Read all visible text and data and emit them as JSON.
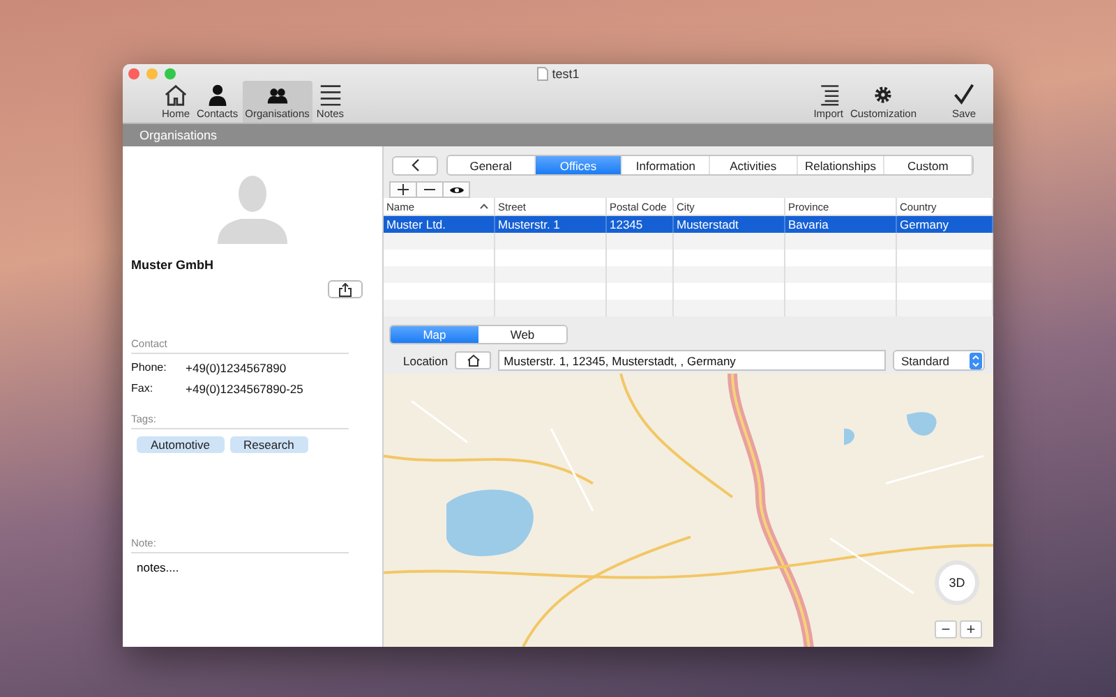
{
  "window": {
    "title": "test1"
  },
  "toolbar": {
    "left": [
      {
        "label": "Home",
        "selected": false
      },
      {
        "label": "Contacts",
        "selected": false
      },
      {
        "label": "Organisations",
        "selected": true
      },
      {
        "label": "Notes",
        "selected": false
      }
    ],
    "right": [
      {
        "label": "Import"
      },
      {
        "label": "Customization"
      },
      {
        "label": "Save"
      }
    ]
  },
  "section_title": "Organisations",
  "profile": {
    "name": "Muster GmbH",
    "contact_heading": "Contact",
    "fields": [
      {
        "label": "Phone:",
        "value": "+49(0)1234567890"
      },
      {
        "label": "Fax:",
        "value": "+49(0)1234567890-25"
      }
    ],
    "tags_heading": "Tags:",
    "tags": [
      "Automotive",
      "Research"
    ],
    "note_heading": "Note:",
    "note": "notes...."
  },
  "tabs": [
    {
      "label": "General",
      "selected": false
    },
    {
      "label": "Offices",
      "selected": true
    },
    {
      "label": "Information",
      "selected": false
    },
    {
      "label": "Activities",
      "selected": false
    },
    {
      "label": "Relationships",
      "selected": false
    },
    {
      "label": "Custom",
      "selected": false
    }
  ],
  "table": {
    "columns": [
      {
        "label": "Name",
        "sorted": true
      },
      {
        "label": "Street",
        "sorted": false
      },
      {
        "label": "Postal Code",
        "sorted": false
      },
      {
        "label": "City",
        "sorted": false
      },
      {
        "label": "Province",
        "sorted": false
      },
      {
        "label": "Country",
        "sorted": false
      }
    ],
    "rows": [
      {
        "cells": [
          "Muster Ltd.",
          "Musterstr. 1",
          "12345",
          "Musterstadt",
          "Bavaria",
          "Germany"
        ],
        "selected": true
      }
    ]
  },
  "view_tabs": [
    {
      "label": "Map",
      "selected": true
    },
    {
      "label": "Web",
      "selected": false
    }
  ],
  "location": {
    "label": "Location",
    "value": "Musterstr. 1, 12345, Musterstadt, , Germany",
    "map_type": "Standard"
  },
  "map_controls": {
    "compass": "3D",
    "zoom_out": "−",
    "zoom_in": "+"
  }
}
